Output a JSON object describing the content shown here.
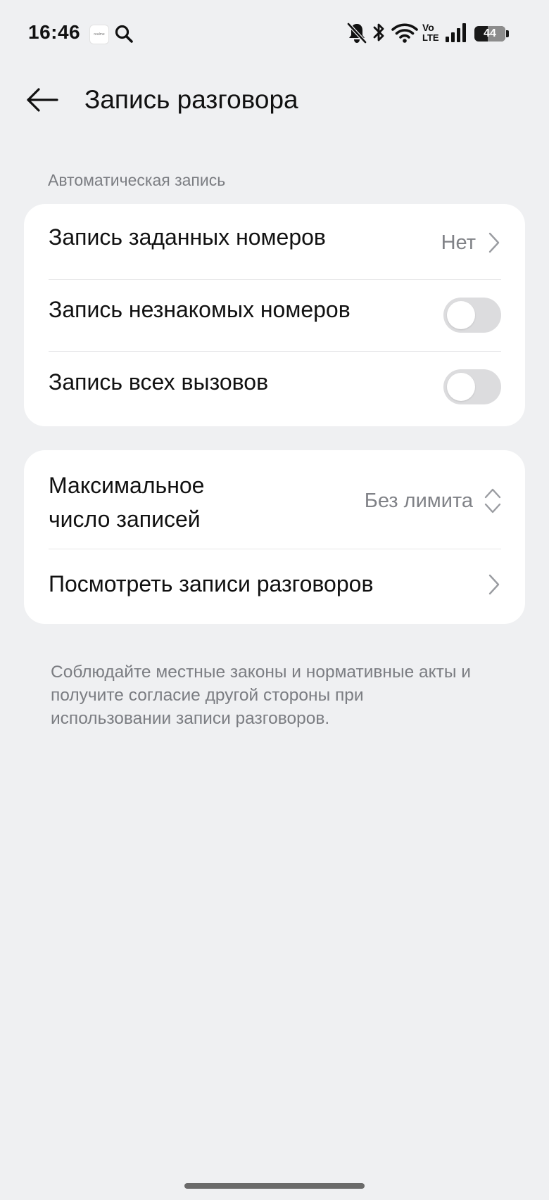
{
  "status_bar": {
    "time": "16:46",
    "app_icon_label": "realme",
    "battery_level": "44",
    "battery_percent": 44,
    "icons": [
      "notifications-off-icon",
      "bluetooth-icon",
      "wifi-icon",
      "volte-icon",
      "cellular-signal-icon",
      "battery-icon"
    ],
    "volte_top": "Vo",
    "volte_bottom": "LTE"
  },
  "header": {
    "back_icon": "back-arrow-icon",
    "title": "Запись разговора"
  },
  "auto_record_section": {
    "label": "Автоматическая запись",
    "items": [
      {
        "label": "Запись заданных номеров",
        "type": "link",
        "value": "Нет"
      },
      {
        "label": "Запись незнакомых номеров",
        "type": "toggle",
        "checked": false
      },
      {
        "label": "Запись всех вызовов",
        "type": "toggle",
        "checked": false
      }
    ]
  },
  "records_section": {
    "items": [
      {
        "label_line1": "Максимальное",
        "label_line2": "число записей",
        "type": "select",
        "value": "Без лимита"
      },
      {
        "label": "Посмотреть записи разговоров",
        "type": "link"
      }
    ]
  },
  "note": "Соблюдайте местные законы и нормативные акты и получите согласие другой стороны при использовании записи разговоров.",
  "colors": {
    "background": "#eff0f2",
    "card": "#ffffff",
    "secondary_text": "#7b7d82",
    "toggle_off": "#dcdcde"
  }
}
